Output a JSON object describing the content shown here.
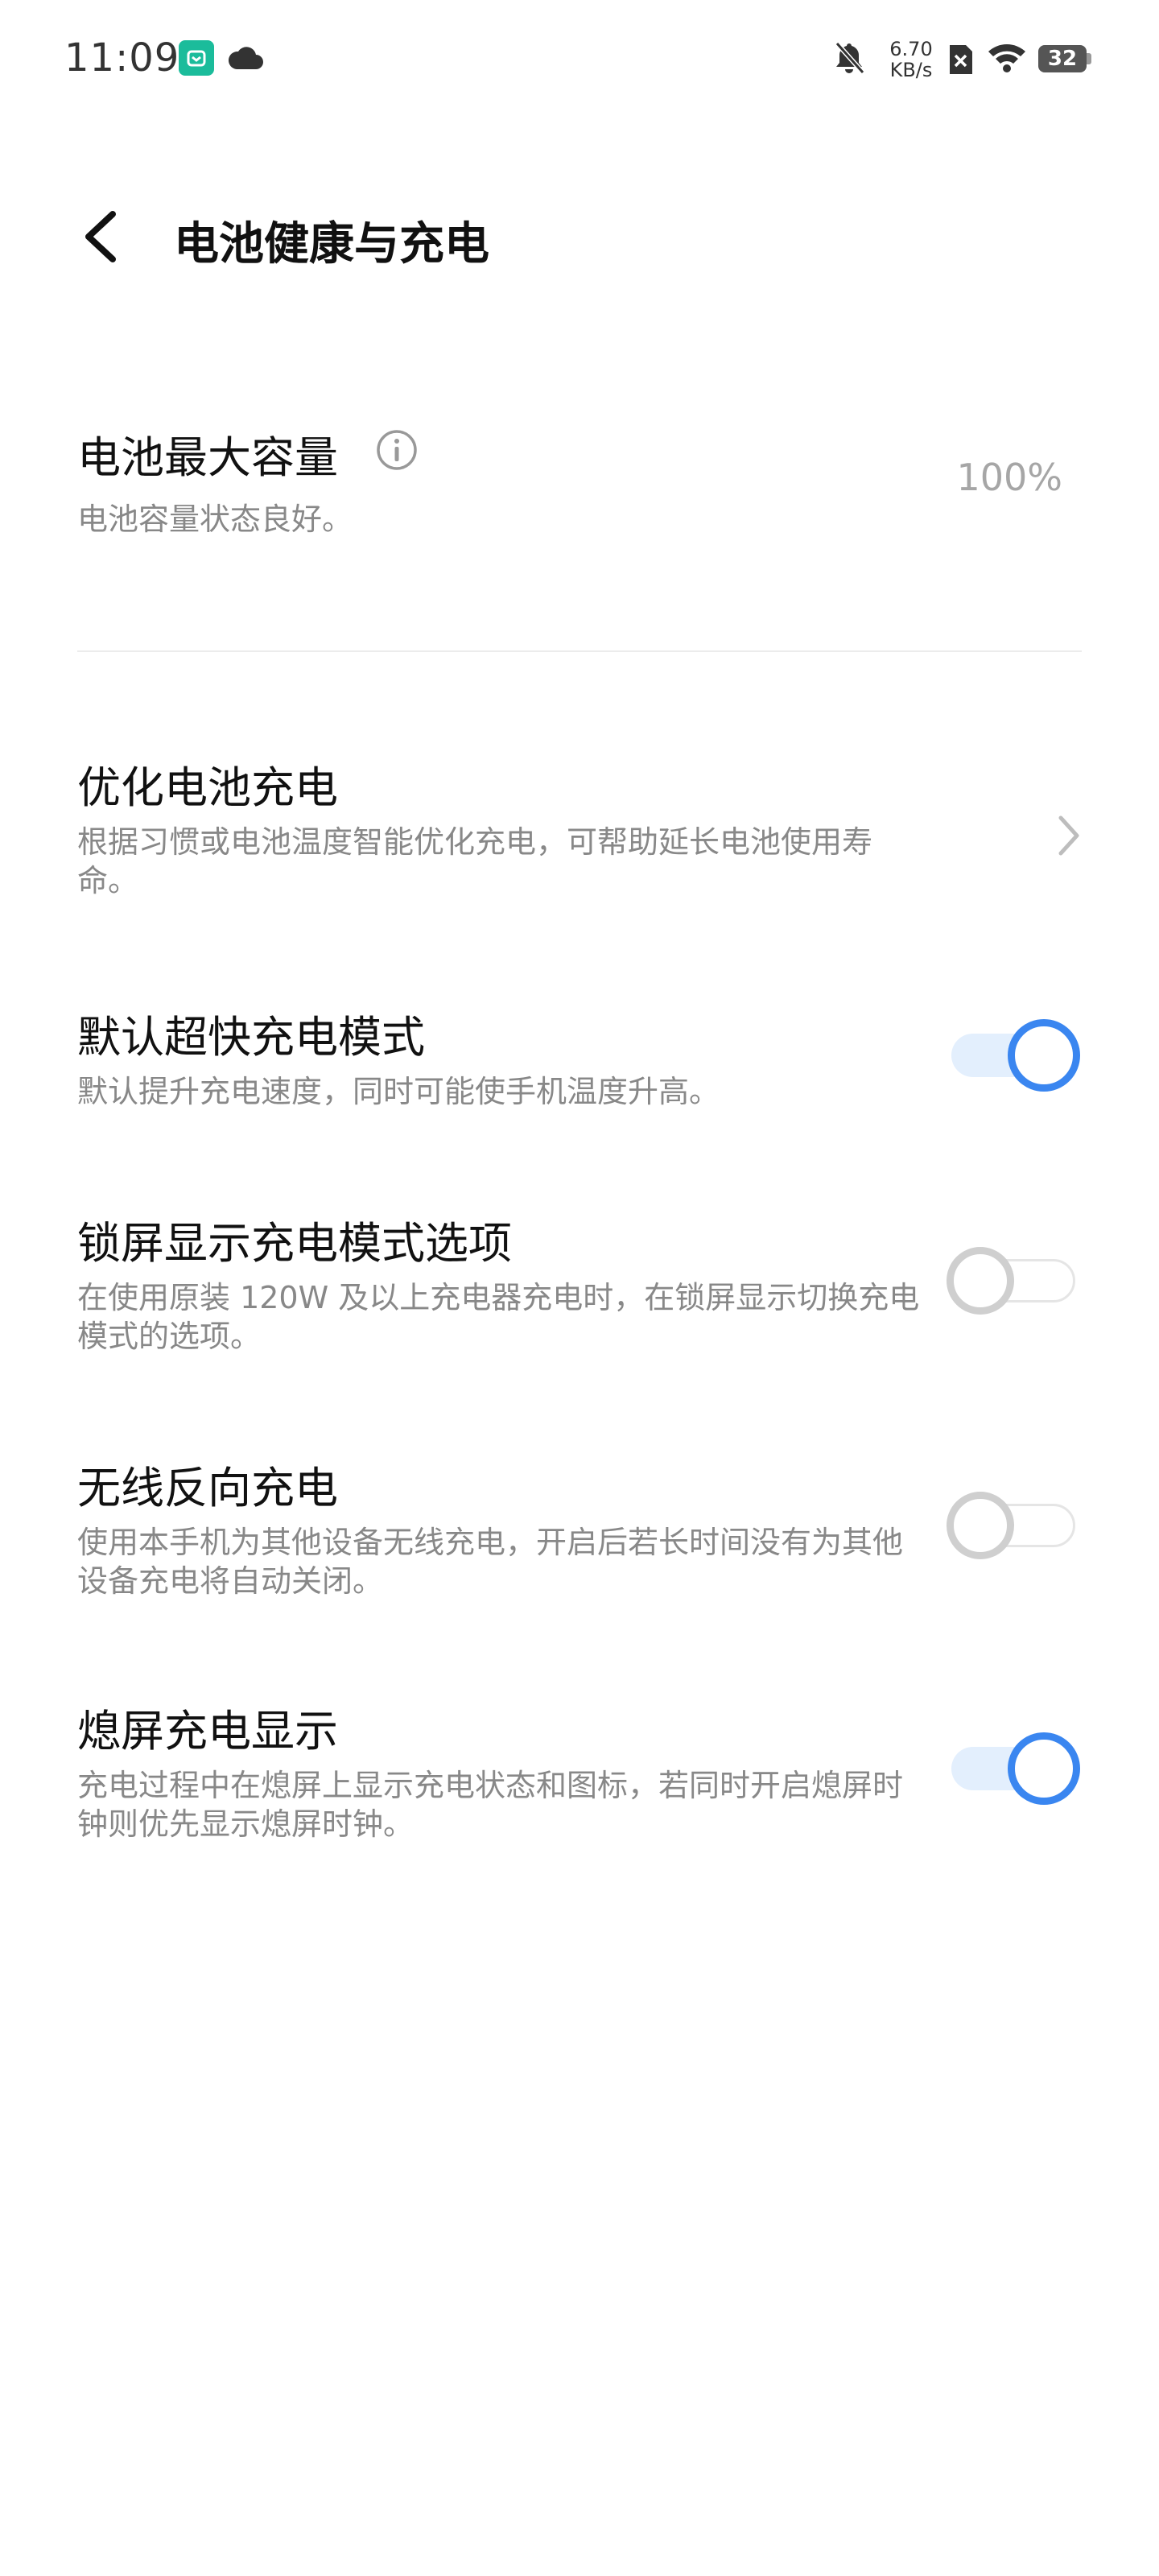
{
  "status_bar": {
    "time": "11:09",
    "speed_value": "6.70",
    "speed_unit": "KB/s",
    "battery": "32",
    "icons": [
      "app-badge-icon",
      "cloud-icon",
      "bell-off-icon",
      "sim-x-icon",
      "wifi-icon",
      "battery-icon"
    ]
  },
  "header": {
    "title": "电池健康与充电"
  },
  "capacity": {
    "title": "电池最大容量",
    "subtitle": "电池容量状态良好。",
    "value": "100%"
  },
  "settings": [
    {
      "title": "优化电池充电",
      "desc": "根据习惯或电池温度智能优化充电，可帮助延长电池使用寿命。",
      "control": "chevron"
    },
    {
      "title": "默认超快充电模式",
      "desc": "默认提升充电速度，同时可能使手机温度升高。",
      "control": "toggle",
      "on": true
    },
    {
      "title": "锁屏显示充电模式选项",
      "desc": "在使用原装 120W 及以上充电器充电时，在锁屏显示切换充电模式的选项。",
      "control": "toggle",
      "on": false
    },
    {
      "title": "无线反向充电",
      "desc": "使用本手机为其他设备无线充电，开启后若长时间没有为其他设备充电将自动关闭。",
      "control": "toggle",
      "on": false
    },
    {
      "title": "熄屏充电显示",
      "desc": "充电过程中在熄屏上显示充电状态和图标，若同时开启熄屏时钟则优先显示熄屏时钟。",
      "control": "toggle",
      "on": true
    }
  ],
  "colors": {
    "accent": "#3a86f0",
    "toggle_on_track": "#e3effd",
    "toggle_off_ring": "#cfcfcf",
    "app_badge": "#1bbc9b"
  }
}
